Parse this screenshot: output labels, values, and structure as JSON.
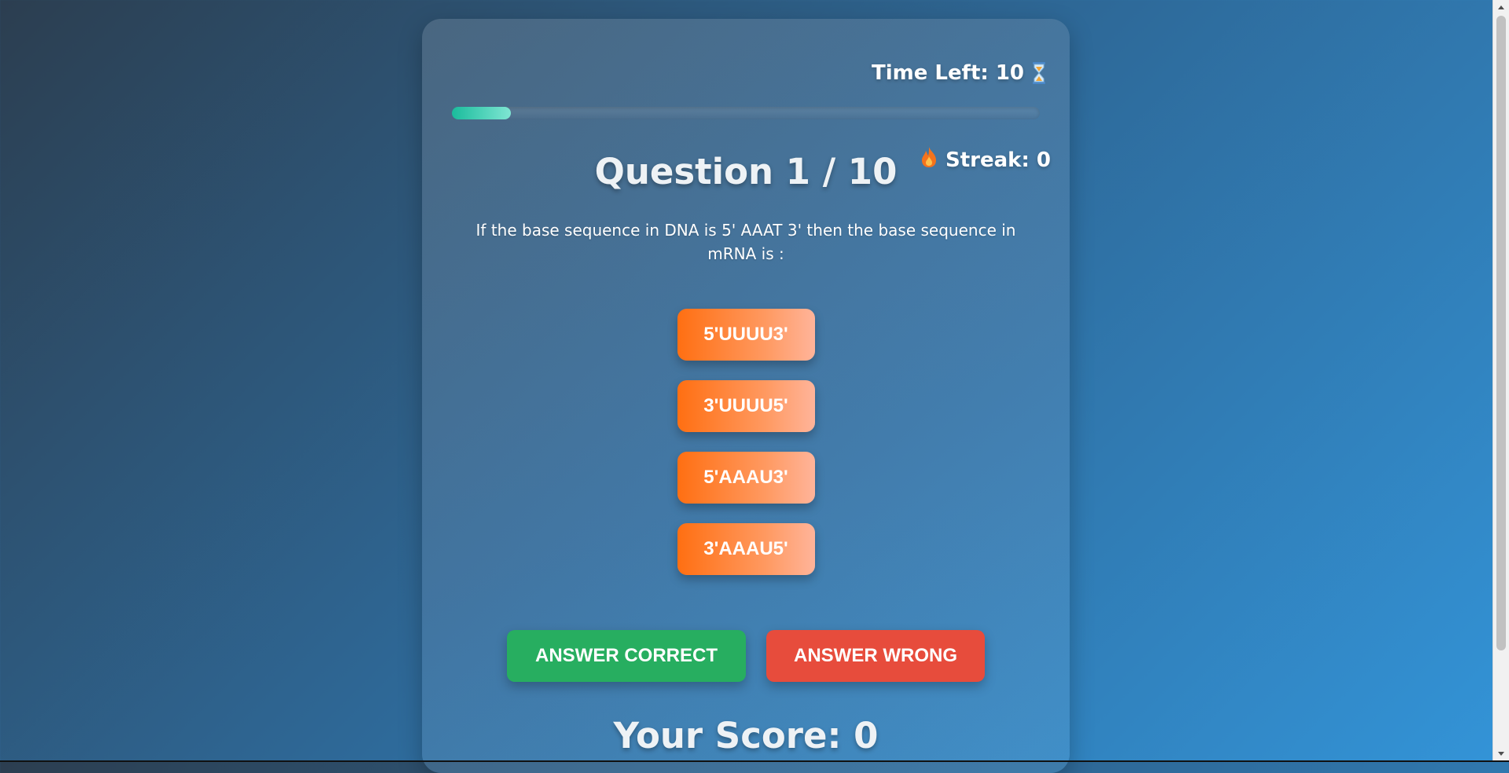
{
  "timer": {
    "label": "Time Left: 10",
    "icon": "hourglass-icon",
    "progress_fraction": 0.1
  },
  "header": {
    "question_title": "Question 1 / 10",
    "streak_label": "Streak: 0",
    "streak_icon": "flame-icon"
  },
  "question": {
    "text": "If the base sequence in DNA is 5' AAAT 3' then the base sequence in mRNA is :"
  },
  "options": [
    {
      "label": "5'UUUU3'"
    },
    {
      "label": "3'UUUU5'"
    },
    {
      "label": "5'AAAU3'"
    },
    {
      "label": "3'AAAU5'"
    }
  ],
  "actions": {
    "correct_label": "ANSWER CORRECT",
    "wrong_label": "ANSWER WRONG"
  },
  "score": {
    "label": "Your Score: 0"
  },
  "colors": {
    "accent_teal": "#1abc9c",
    "option_orange": "#ff6f12",
    "correct_green": "#27ae60",
    "wrong_red": "#e74c3c"
  }
}
